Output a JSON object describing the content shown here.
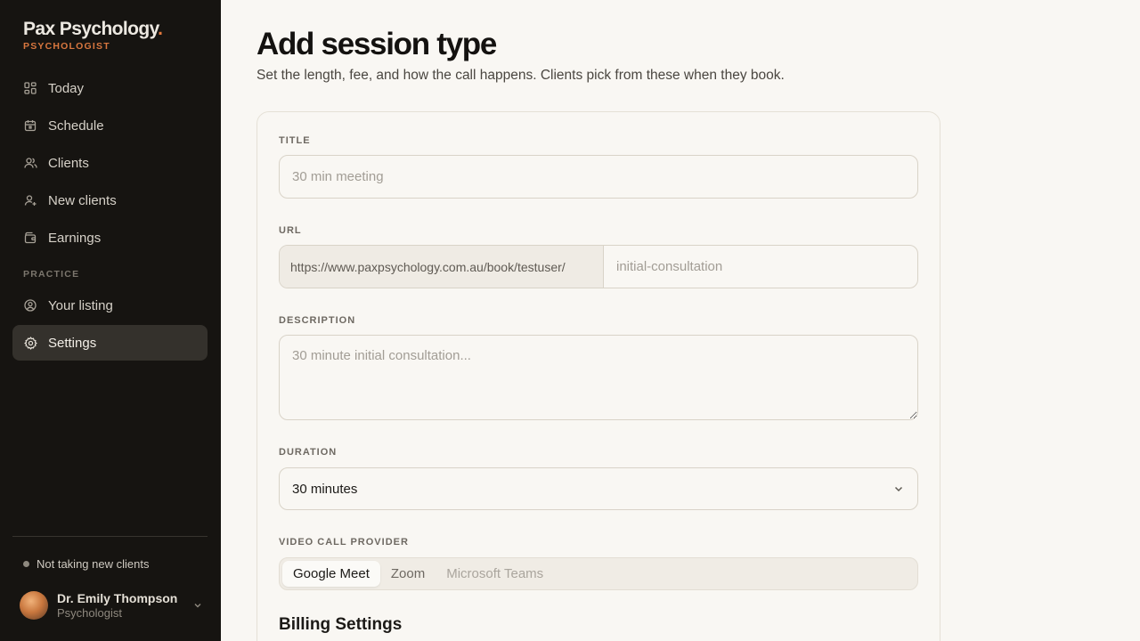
{
  "brand": {
    "name": "Pax Psychology",
    "dot": ".",
    "role": "PSYCHOLOGIST"
  },
  "nav": {
    "items": [
      {
        "label": "Today",
        "icon": "grid-icon"
      },
      {
        "label": "Schedule",
        "icon": "calendar-icon"
      },
      {
        "label": "Clients",
        "icon": "users-icon"
      },
      {
        "label": "New clients",
        "icon": "user-plus-icon"
      },
      {
        "label": "Earnings",
        "icon": "wallet-icon"
      }
    ],
    "practice_label": "PRACTICE",
    "practice_items": [
      {
        "label": "Your listing",
        "icon": "user-circle-icon"
      },
      {
        "label": "Settings",
        "icon": "gear-icon",
        "active": true
      }
    ]
  },
  "status": {
    "label": "Not taking new clients"
  },
  "user": {
    "name": "Dr. Emily Thompson",
    "role": "Psychologist"
  },
  "page": {
    "title": "Add session type",
    "subtitle": "Set the length, fee, and how the call happens. Clients pick from these when they book."
  },
  "form": {
    "title_label": "TITLE",
    "title_placeholder": "30 min meeting",
    "url_label": "URL",
    "url_prefix": "https://www.paxpsychology.com.au/book/testuser/",
    "url_placeholder": "initial-consultation",
    "description_label": "DESCRIPTION",
    "description_placeholder": "30 minute initial consultation...",
    "duration_label": "DURATION",
    "duration_value": "30 minutes",
    "provider_label": "VIDEO CALL PROVIDER",
    "providers": [
      "Google Meet",
      "Zoom",
      "Microsoft Teams"
    ],
    "billing_title": "Billing Settings"
  },
  "colors": {
    "accent": "#e0763c",
    "sidebar_bg": "#161411",
    "page_bg": "#f9f7f3"
  }
}
